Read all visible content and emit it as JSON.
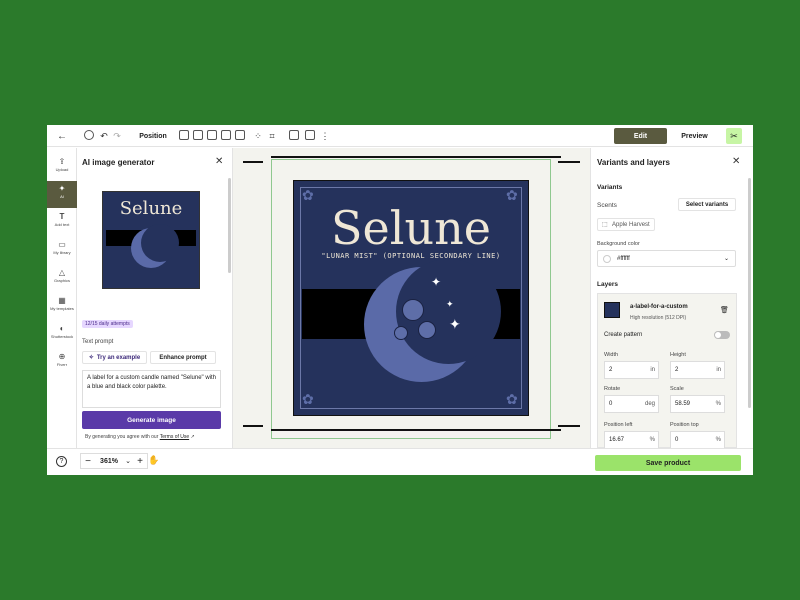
{
  "toolbar": {
    "position_label": "Position",
    "edit_label": "Edit",
    "preview_label": "Preview"
  },
  "rail": {
    "items": [
      {
        "label": "Upload",
        "icon": "upload-icon"
      },
      {
        "label": "AI",
        "icon": "sparkle-icon"
      },
      {
        "label": "Add text",
        "icon": "text-icon"
      },
      {
        "label": "My library",
        "icon": "folder-icon"
      },
      {
        "label": "Graphics",
        "icon": "shapes-icon"
      },
      {
        "label": "My templates",
        "icon": "templates-icon"
      },
      {
        "label": "Shutterstock",
        "icon": "shutterstock-icon"
      },
      {
        "label": "Fiverr",
        "icon": "fiverr-icon"
      }
    ]
  },
  "generator": {
    "title": "AI image generator",
    "thumb_title": "Selune",
    "attempts": "12/15 daily attempts",
    "prompt_label": "Text prompt",
    "try_label": "Try an example",
    "enhance_label": "Enhance prompt",
    "prompt_text": "A label for a custom candle named \"Selune\" with a blue and black color palette.",
    "generate_label": "Generate image",
    "terms_prefix": "By generating you agree with our",
    "terms_link": "Terms of Use"
  },
  "canvas": {
    "label_title": "Selune",
    "label_subtitle": "\"LUNAR MIST\" (OPTIONAL SECONDARY LINE)"
  },
  "variants": {
    "title": "Variants and layers",
    "variants_heading": "Variants",
    "scents_label": "Scents",
    "select_variants_label": "Select variants",
    "scent_chip": "Apple Harvest",
    "bg_color_label": "Background color",
    "bg_color_value": "#ffffff",
    "layers_heading": "Layers",
    "layer_name": "a-label-for-a-custom",
    "layer_resolution": "High resolution (512 DPI)",
    "create_pattern_label": "Create pattern",
    "width_label": "Width",
    "width_value": "2",
    "width_unit": "in",
    "height_label": "Height",
    "height_value": "2",
    "height_unit": "in",
    "rotate_label": "Rotate",
    "rotate_value": "0",
    "rotate_unit": "deg",
    "scale_label": "Scale",
    "scale_value": "58.59",
    "scale_unit": "%",
    "pos_left_label": "Position left",
    "pos_left_value": "16.67",
    "pos_left_unit": "%",
    "pos_top_label": "Position top",
    "pos_top_value": "0",
    "pos_top_unit": "%"
  },
  "bottom": {
    "zoom_value": "361%",
    "save_label": "Save product"
  },
  "colors": {
    "background": "#2b7a2b",
    "label_navy": "#25325c",
    "accent_purple": "#5a3aa8",
    "save_green": "#9be36a",
    "edit_dark": "#5a5a3f"
  }
}
